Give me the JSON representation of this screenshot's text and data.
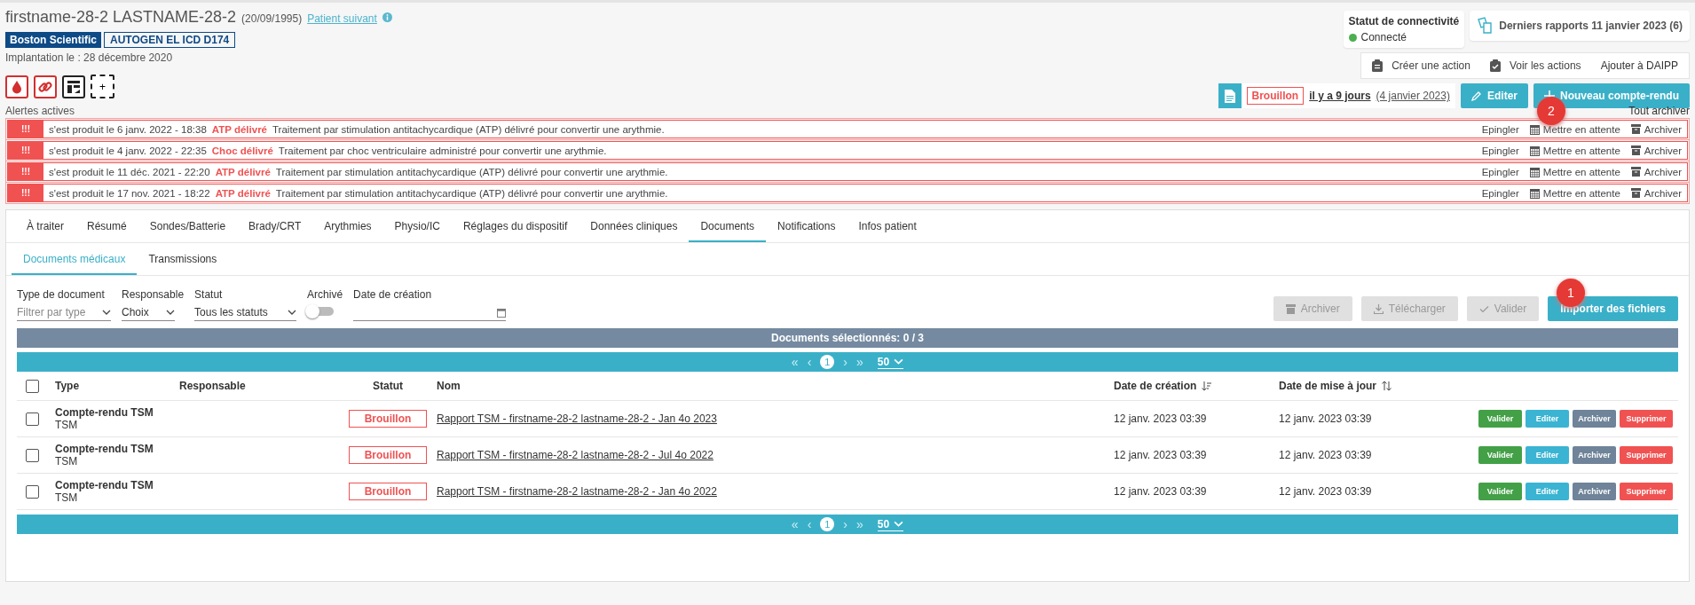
{
  "patient": {
    "name": "firstname-28-2 LASTNAME-28-2",
    "birth_date": "(20/09/1995)",
    "next_link": "Patient suivant",
    "manufacturer": "Boston Scientific",
    "device": "AUTOGEN EL ICD D174",
    "implant_date": "Implantation le : 28 décembre 2020",
    "add_label": "+"
  },
  "connectivity": {
    "title": "Statut de connectivité",
    "status": "Connecté",
    "color": "#4caf50"
  },
  "reports": {
    "label": "Derniers rapports 11 janvier 2023 (6)"
  },
  "actions": {
    "create": "Créer une action",
    "view": "Voir les actions",
    "daipp": "Ajouter à DAIPP"
  },
  "draft": {
    "status": "Brouillon",
    "ago": "il y a 9 jours",
    "date": "(4 janvier 2023)"
  },
  "header_buttons": {
    "edit": "Editer",
    "new": "Nouveau compte-rendu"
  },
  "annotations": [
    {
      "label": "2",
      "kind": "header"
    },
    {
      "label": "1",
      "kind": "import"
    }
  ],
  "alerts": {
    "title": "Alertes actives",
    "archive_all": "Tout archiver",
    "items": [
      {
        "badge": "!!!",
        "date_text": "s'est produit le 6 janv. 2022 - 18:38",
        "type": "ATP délivré",
        "description": "Traitement par stimulation antitachycardique (ATP) délivré pour convertir une arythmie.",
        "pin": "Epingler",
        "hold": "Mettre en attente",
        "archive": "Archiver"
      },
      {
        "badge": "!!!",
        "date_text": "s'est produit le 4 janv. 2022 - 22:35",
        "type": "Choc délivré",
        "description": "Traitement par choc ventriculaire administré pour convertir une arythmie.",
        "pin": "Epingler",
        "hold": "Mettre en attente",
        "archive": "Archiver"
      },
      {
        "badge": "!!!",
        "date_text": "s'est produit le 11 déc. 2021 - 22:20",
        "type": "ATP délivré",
        "description": "Traitement par stimulation antitachycardique (ATP) délivré pour convertir une arythmie.",
        "pin": "Epingler",
        "hold": "Mettre en attente",
        "archive": "Archiver"
      },
      {
        "badge": "!!!",
        "date_text": "s'est produit le 17 nov. 2021 - 18:22",
        "type": "ATP délivré",
        "description": "Traitement par stimulation antitachycardique (ATP) délivré pour convertir une arythmie.",
        "pin": "Epingler",
        "hold": "Mettre en attente",
        "archive": "Archiver"
      }
    ]
  },
  "tabs": [
    {
      "label": "À traiter",
      "selected": false
    },
    {
      "label": "Résumé",
      "selected": false
    },
    {
      "label": "Sondes/Batterie",
      "selected": false
    },
    {
      "label": "Brady/CRT",
      "selected": false
    },
    {
      "label": "Arythmies",
      "selected": false
    },
    {
      "label": "Physio/IC",
      "selected": false
    },
    {
      "label": "Réglages du dispositif",
      "selected": false
    },
    {
      "label": "Données cliniques",
      "selected": false
    },
    {
      "label": "Documents",
      "selected": true
    },
    {
      "label": "Notifications",
      "selected": false
    },
    {
      "label": "Infos patient",
      "selected": false
    }
  ],
  "subtabs": [
    {
      "label": "Documents médicaux",
      "selected": true
    },
    {
      "label": "Transmissions",
      "selected": false
    }
  ],
  "filters": {
    "type": {
      "label": "Type de document",
      "placeholder": "Filtrer par type"
    },
    "owner": {
      "label": "Responsable",
      "value": "Choix"
    },
    "status": {
      "label": "Statut",
      "value": "Tous les statuts"
    },
    "archived": {
      "label": "Archivé",
      "on": false
    },
    "created": {
      "label": "Date de création"
    }
  },
  "toolbar": [
    {
      "label": "Archiver",
      "kind": "archive",
      "disabled": true
    },
    {
      "label": "Télécharger",
      "kind": "download",
      "disabled": true
    },
    {
      "label": "Valider",
      "kind": "validate",
      "disabled": true
    },
    {
      "label": "Importer des fichiers",
      "kind": "import",
      "disabled": false
    }
  ],
  "selection": "Documents sélectionnés: 0 / 3",
  "pagers": [
    {
      "first": "«",
      "prev": "‹",
      "page": "1",
      "next": "›",
      "last": "»",
      "size": "50"
    },
    {
      "first": "«",
      "prev": "‹",
      "page": "1",
      "next": "›",
      "last": "»",
      "size": "50"
    }
  ],
  "table": {
    "select_all": {
      "checked": false
    },
    "columns": [
      "Type",
      "Responsable",
      "Statut",
      "Nom",
      "Date de création",
      "Date de mise à jour"
    ],
    "rows": [
      {
        "checked": false,
        "type": "Compte-rendu TSM",
        "subtype": "TSM",
        "status": "Brouillon",
        "name": "Rapport TSM - firstname-28-2 lastname-28-2 - Jan 4o 2023",
        "created": "12 janv. 2023 03:39",
        "updated": "12 janv. 2023 03:39",
        "buttons": [
          {
            "label": "Valider",
            "kind": "validate"
          },
          {
            "label": "Editer",
            "kind": "edit"
          },
          {
            "label": "Archiver",
            "kind": "archive"
          },
          {
            "label": "Supprimer",
            "kind": "delete"
          }
        ]
      },
      {
        "checked": false,
        "type": "Compte-rendu TSM",
        "subtype": "TSM",
        "status": "Brouillon",
        "name": "Rapport TSM - firstname-28-2 lastname-28-2 - Jul 4o 2022",
        "created": "12 janv. 2023 03:39",
        "updated": "12 janv. 2023 03:39",
        "buttons": [
          {
            "label": "Valider",
            "kind": "validate"
          },
          {
            "label": "Editer",
            "kind": "edit"
          },
          {
            "label": "Archiver",
            "kind": "archive"
          },
          {
            "label": "Supprimer",
            "kind": "delete"
          }
        ]
      },
      {
        "checked": false,
        "type": "Compte-rendu TSM",
        "subtype": "TSM",
        "status": "Brouillon",
        "name": "Rapport TSM - firstname-28-2 lastname-28-2 - Jan 4o 2022",
        "created": "12 janv. 2023 03:39",
        "updated": "12 janv. 2023 03:39",
        "buttons": [
          {
            "label": "Valider",
            "kind": "validate"
          },
          {
            "label": "Editer",
            "kind": "edit"
          },
          {
            "label": "Archiver",
            "kind": "archive"
          },
          {
            "label": "Supprimer",
            "kind": "delete"
          }
        ]
      }
    ]
  }
}
